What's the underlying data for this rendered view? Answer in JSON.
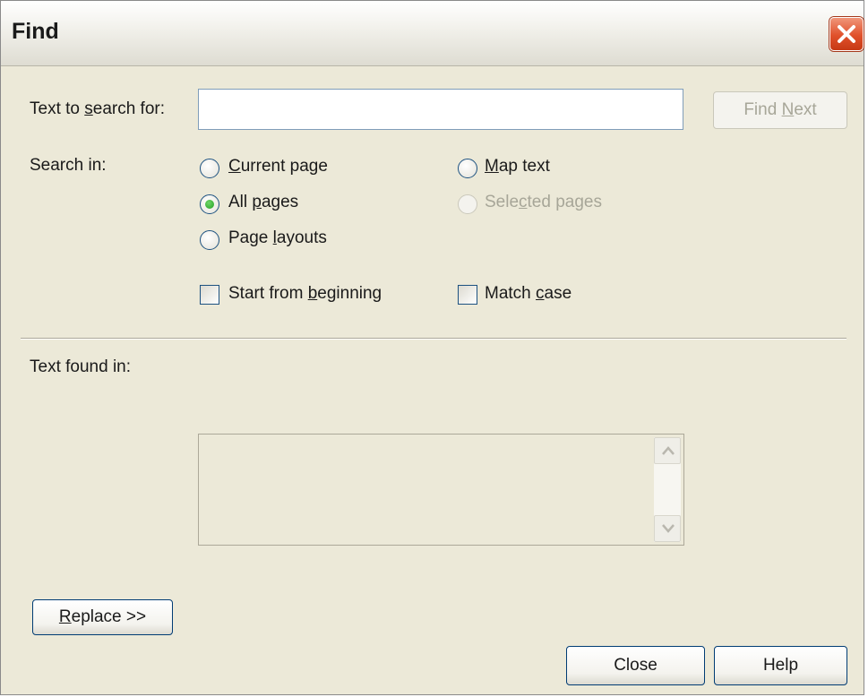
{
  "window": {
    "title": "Find"
  },
  "search": {
    "label_pre": "Text to ",
    "label_key": "s",
    "label_post": "earch for:",
    "value": "",
    "find_next_pre": "Find ",
    "find_next_key": "N",
    "find_next_post": "ext"
  },
  "search_in": {
    "label": "Search in:",
    "current_page": {
      "pre": "",
      "key": "C",
      "post": "urrent page",
      "selected": false
    },
    "all_pages": {
      "pre": "All ",
      "key": "p",
      "post": "ages",
      "selected": true
    },
    "page_layouts": {
      "pre": "Page ",
      "key": "l",
      "post": "ayouts",
      "selected": false
    },
    "map_text": {
      "pre": "",
      "key": "M",
      "post": "ap text",
      "selected": false
    },
    "selected_pages": {
      "pre": "Sele",
      "key": "c",
      "post": "ted pages",
      "selected": false,
      "disabled": true
    }
  },
  "options": {
    "start_from_beginning": {
      "pre": "Start from ",
      "key": "b",
      "post": "eginning",
      "checked": false
    },
    "match_case": {
      "pre": "Match ",
      "key": "c",
      "post": "ase",
      "checked": false
    }
  },
  "results": {
    "label": "Text found in:"
  },
  "buttons": {
    "replace_key": "R",
    "replace_post": "eplace >>",
    "close": "Close",
    "help": "Help"
  },
  "colors": {
    "dialog_bg": "#ece9d8",
    "close_button": "#e0502b",
    "radio_dot": "#21a121",
    "control_border": "#1c5180"
  },
  "icons": [
    "close-icon",
    "scroll-up-arrow-icon",
    "scroll-down-arrow-icon"
  ]
}
